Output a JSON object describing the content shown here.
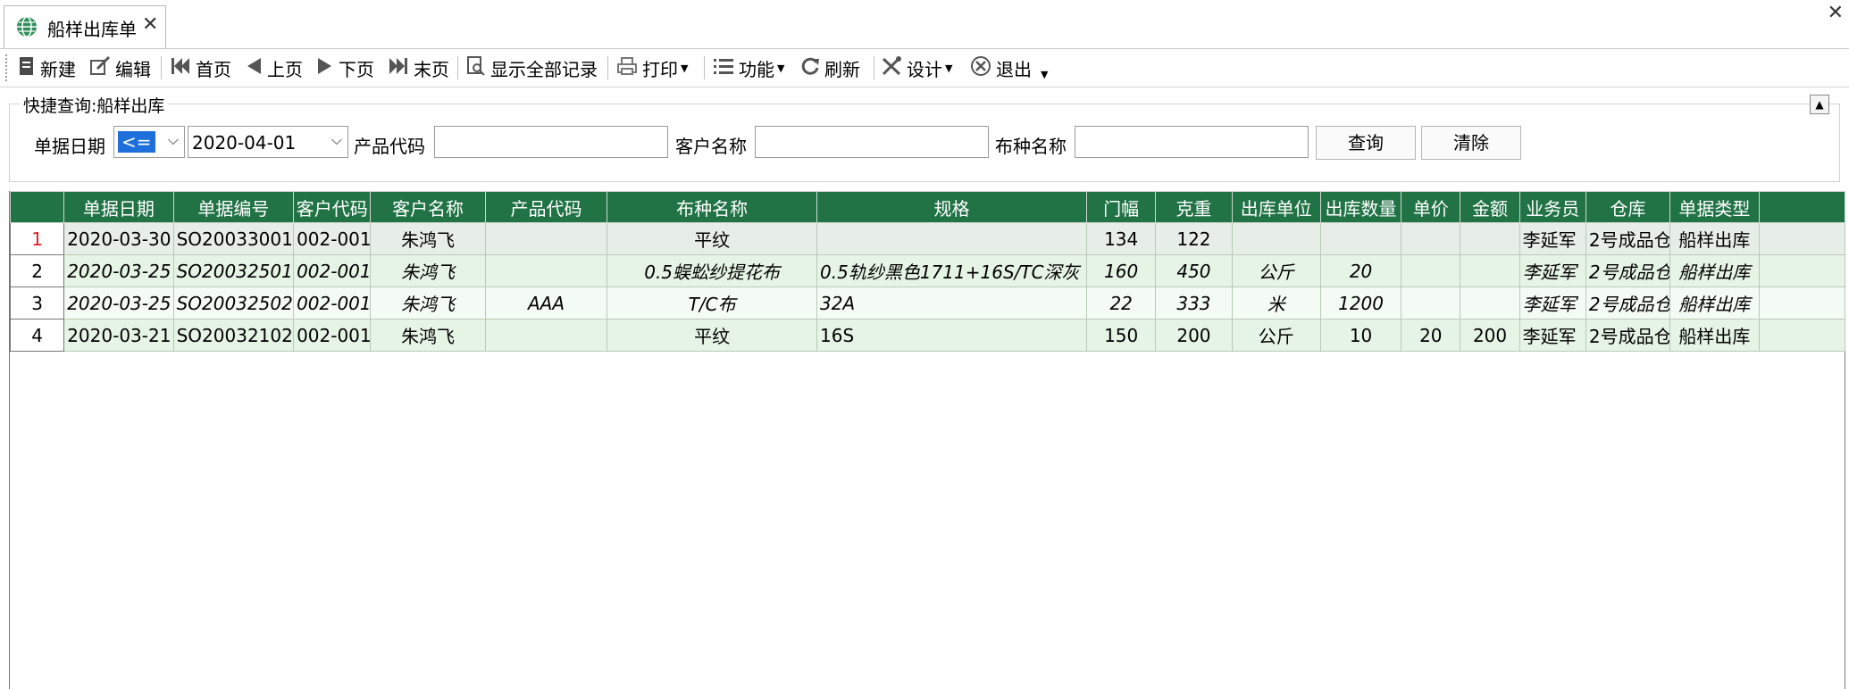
{
  "window": {
    "tab_title": "船样出库单",
    "tab_close_glyph": "✕",
    "close_glyph": "✕"
  },
  "toolbar": {
    "items": [
      {
        "label": "新建",
        "icon": "new-doc-icon"
      },
      {
        "label": "编辑",
        "icon": "edit-icon"
      },
      {
        "label": "首页",
        "icon": "first-page-icon"
      },
      {
        "label": "上页",
        "icon": "prev-page-icon"
      },
      {
        "label": "下页",
        "icon": "next-page-icon"
      },
      {
        "label": "末页",
        "icon": "last-page-icon"
      },
      {
        "label": "显示全部记录",
        "icon": "show-all-icon"
      },
      {
        "label": "打印",
        "icon": "print-icon"
      },
      {
        "label": "功能",
        "icon": "list-icon"
      },
      {
        "label": "刷新",
        "icon": "refresh-icon"
      },
      {
        "label": "设计",
        "icon": "design-tools-icon"
      },
      {
        "label": "退出",
        "icon": "exit-icon"
      }
    ]
  },
  "quick_query": {
    "title": "快捷查询:船样出库",
    "date_label": "单据日期",
    "date_operator": "<=",
    "date_value": "2020-04-01",
    "product_code_label": "产品代码",
    "product_code_value": "",
    "customer_name_label": "客户名称",
    "customer_name_value": "",
    "fabric_name_label": "布种名称",
    "fabric_name_value": "",
    "query_button": "查询",
    "clear_button": "清除"
  },
  "grid": {
    "columns": [
      "单据日期",
      "单据编号",
      "客户代码",
      "客户名称",
      "产品代码",
      "布种名称",
      "规格",
      "门幅",
      "克重",
      "出库单位",
      "出库数量",
      "单价",
      "金额",
      "业务员",
      "仓库",
      "单据类型"
    ],
    "rows": [
      {
        "no": "1",
        "date": "2020-03-30",
        "doc_no": "SO20033001",
        "cust_code": "002-001",
        "cust_name": "朱鸿飞",
        "prod_code": "",
        "fabric": "平纹",
        "spec": "",
        "width": "134",
        "weight": "122",
        "unit": "",
        "qty": "",
        "price": "",
        "amount": "",
        "sales": "李延军",
        "warehouse": "2号成品仓",
        "doc_type": "船样出库"
      },
      {
        "no": "2",
        "date": "2020-03-25",
        "doc_no": "SO20032501",
        "cust_code": "002-001",
        "cust_name": "朱鸿飞",
        "prod_code": "",
        "fabric": "0.5蜈蚣纱提花布",
        "spec": "0.5轨纱黑色1711+16S/TC深灰",
        "width": "160",
        "weight": "450",
        "unit": "公斤",
        "qty": "20",
        "price": "",
        "amount": "",
        "sales": "李延军",
        "warehouse": "2号成品仓",
        "doc_type": "船样出库"
      },
      {
        "no": "3",
        "date": "2020-03-25",
        "doc_no": "SO20032502",
        "cust_code": "002-001",
        "cust_name": "朱鸿飞",
        "prod_code": "AAA",
        "fabric": "T/C布",
        "spec": "32A",
        "width": "22",
        "weight": "333",
        "unit": "米",
        "qty": "1200",
        "price": "",
        "amount": "",
        "sales": "李延军",
        "warehouse": "2号成品仓",
        "doc_type": "船样出库"
      },
      {
        "no": "4",
        "date": "2020-03-21",
        "doc_no": "SO20032102",
        "cust_code": "002-001",
        "cust_name": "朱鸿飞",
        "prod_code": "",
        "fabric": "平纹",
        "spec": "16S",
        "width": "150",
        "weight": "200",
        "unit": "公斤",
        "qty": "10",
        "price": "20",
        "amount": "200",
        "sales": "李延军",
        "warehouse": "2号成品仓",
        "doc_type": "船样出库"
      }
    ]
  },
  "colors": {
    "header_bg": "#217346",
    "row_alt_bg": "#e6f4e6",
    "row_bg": "#f4fbf4",
    "selected_row_number": "#dd2222",
    "operator_highlight": "#1e6fd9"
  }
}
